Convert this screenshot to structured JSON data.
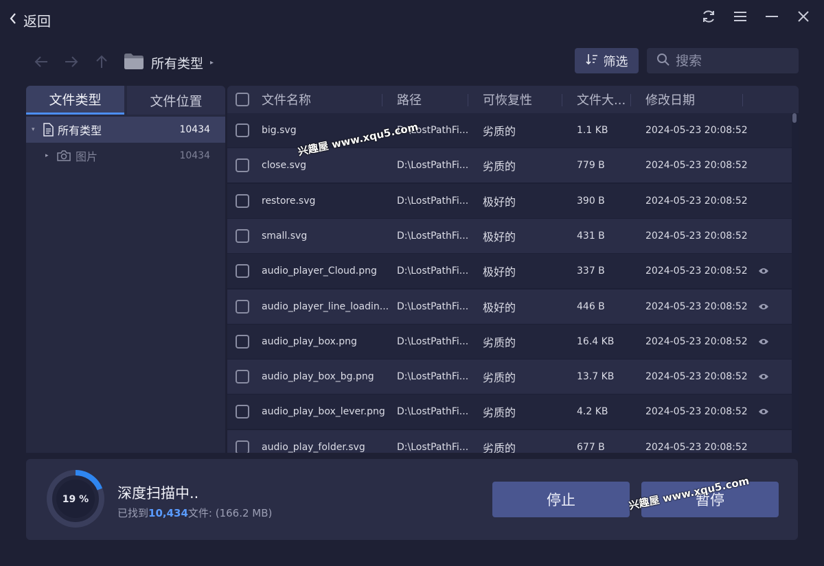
{
  "titlebar": {
    "back_label": "返回"
  },
  "toolbar": {
    "breadcrumb": "所有类型",
    "filter_label": "筛选",
    "search_placeholder": "搜索"
  },
  "sidebar": {
    "tabs": [
      {
        "label": "文件类型",
        "active": true
      },
      {
        "label": "文件位置",
        "active": false
      }
    ],
    "tree": [
      {
        "label": "所有类型",
        "count": "10434",
        "icon": "document-icon",
        "selected": true
      },
      {
        "label": "图片",
        "count": "10434",
        "icon": "camera-icon",
        "selected": false
      }
    ]
  },
  "table": {
    "columns": [
      "文件名称",
      "路径",
      "可恢复性",
      "文件大...",
      "修改日期"
    ],
    "rows": [
      {
        "name": "big.svg",
        "path": "D:\\LostPathFi...",
        "recoverability": "劣质的",
        "size": "1.1 KB",
        "date": "2024-05-23 20:08:52",
        "preview": false
      },
      {
        "name": "close.svg",
        "path": "D:\\LostPathFi...",
        "recoverability": "劣质的",
        "size": "779 B",
        "date": "2024-05-23 20:08:52",
        "preview": false
      },
      {
        "name": "restore.svg",
        "path": "D:\\LostPathFi...",
        "recoverability": "极好的",
        "size": "390 B",
        "date": "2024-05-23 20:08:52",
        "preview": false
      },
      {
        "name": "small.svg",
        "path": "D:\\LostPathFi...",
        "recoverability": "极好的",
        "size": "431 B",
        "date": "2024-05-23 20:08:52",
        "preview": false
      },
      {
        "name": "audio_player_Cloud.png",
        "path": "D:\\LostPathFi...",
        "recoverability": "极好的",
        "size": "337 B",
        "date": "2024-05-23 20:08:52",
        "preview": true
      },
      {
        "name": "audio_player_line_loadin...",
        "path": "D:\\LostPathFi...",
        "recoverability": "极好的",
        "size": "446 B",
        "date": "2024-05-23 20:08:52",
        "preview": true
      },
      {
        "name": "audio_play_box.png",
        "path": "D:\\LostPathFi...",
        "recoverability": "劣质的",
        "size": "16.4 KB",
        "date": "2024-05-23 20:08:52",
        "preview": true
      },
      {
        "name": "audio_play_box_bg.png",
        "path": "D:\\LostPathFi...",
        "recoverability": "劣质的",
        "size": "13.7 KB",
        "date": "2024-05-23 20:08:52",
        "preview": true
      },
      {
        "name": "audio_play_box_lever.png",
        "path": "D:\\LostPathFi...",
        "recoverability": "劣质的",
        "size": "4.2 KB",
        "date": "2024-05-23 20:08:52",
        "preview": true
      },
      {
        "name": "audio_play_folder.svg",
        "path": "D:\\LostPathFi...",
        "recoverability": "劣质的",
        "size": "677 B",
        "date": "2024-05-23 20:08:52",
        "preview": false
      }
    ]
  },
  "scan": {
    "progress_percent": 19,
    "progress_label": "19 %",
    "title": "深度扫描中..",
    "found_prefix": "已找到",
    "found_count": "10,434",
    "found_suffix": "文件: (166.2 MB)",
    "stop_label": "停止",
    "pause_label": "暂停"
  },
  "watermark": {
    "text": "兴趣屋 www.xqu5.com"
  },
  "colors": {
    "accent": "#4c8ef5",
    "background": "#1e2034",
    "button": "#4a5690"
  }
}
